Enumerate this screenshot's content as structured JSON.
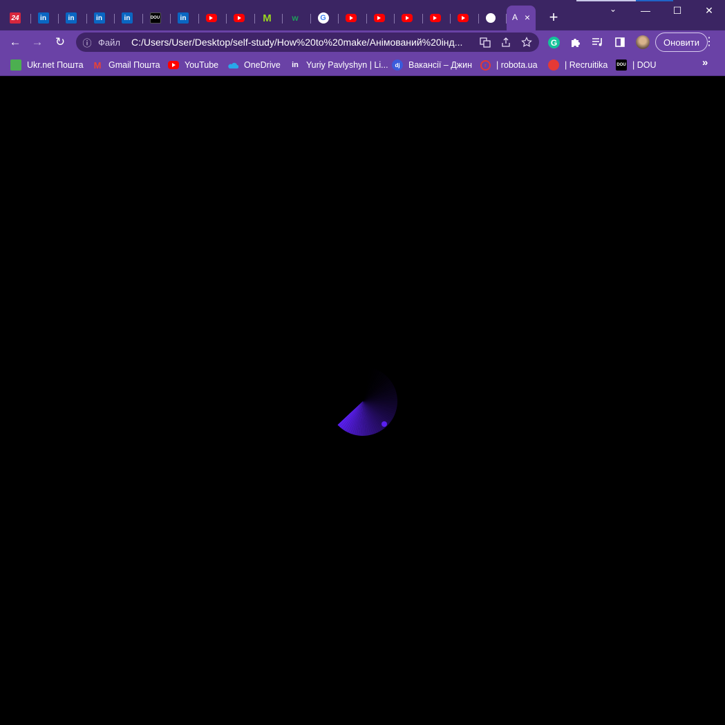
{
  "browser": {
    "tabs": [
      {
        "icon": "news24-favicon",
        "label": "24"
      },
      {
        "icon": "linkedin-favicon",
        "label": "in"
      },
      {
        "icon": "linkedin-favicon",
        "label": "in"
      },
      {
        "icon": "linkedin-favicon",
        "label": "in"
      },
      {
        "icon": "linkedin-favicon",
        "label": "in"
      },
      {
        "icon": "dou-favicon",
        "label": "DOU"
      },
      {
        "icon": "linkedin-favicon",
        "label": "in"
      },
      {
        "icon": "youtube-favicon",
        "label": ""
      },
      {
        "icon": "youtube-favicon",
        "label": ""
      },
      {
        "icon": "m-favicon",
        "label": "M"
      },
      {
        "icon": "w-favicon",
        "label": "w"
      },
      {
        "icon": "google-favicon",
        "label": "G"
      },
      {
        "icon": "youtube-favicon",
        "label": ""
      },
      {
        "icon": "youtube-favicon",
        "label": ""
      },
      {
        "icon": "youtube-favicon",
        "label": ""
      },
      {
        "icon": "youtube-favicon",
        "label": ""
      },
      {
        "icon": "youtube-favicon",
        "label": ""
      },
      {
        "icon": "globe-favicon",
        "label": ""
      }
    ],
    "active_tab_title_fragment": "A",
    "active_tab_close": "×",
    "new_tab": "+",
    "window_controls": {
      "tab_search": "⌄",
      "minimize": "—",
      "maximize": "☐",
      "close": "✕"
    },
    "toolbar": {
      "back": "←",
      "forward": "→",
      "reload": "↻",
      "info_icon": "ⓘ",
      "scheme_chip": "Файл",
      "url": "C:/Users/User/Desktop/self-study/How%20to%20make/Анімований%20інд...",
      "update_button": "Оновити",
      "menu": "⋮"
    },
    "bookmarks": [
      {
        "label": "Ukr.net Пошта",
        "icon": "ukrnet-icon"
      },
      {
        "label": "Gmail Пошта",
        "icon": "gmail-icon"
      },
      {
        "label": "YouTube",
        "icon": "youtube-icon"
      },
      {
        "label": "OneDrive",
        "icon": "onedrive-icon"
      },
      {
        "label": "Yuriy Pavlyshyn | Li...",
        "icon": "linkedin-icon"
      },
      {
        "label": "Вакансії – Джин",
        "icon": "djinni-icon"
      },
      {
        "label": "| robota.ua",
        "icon": "robota-icon"
      },
      {
        "label": "| Recruitika",
        "icon": "recruitika-icon"
      },
      {
        "label": "| DOU",
        "icon": "dou-icon"
      }
    ],
    "bookmarks_overflow": "»"
  },
  "colors": {
    "tabstrip": "#3b2563",
    "toolbar": "#6a42a6",
    "omnibox": "#3f2467",
    "page_background": "#000000",
    "spinner": "#5a1ff0"
  },
  "page": {
    "loader": {
      "type": "animated-conic-spinner",
      "sweep_fraction": 0.38
    }
  }
}
